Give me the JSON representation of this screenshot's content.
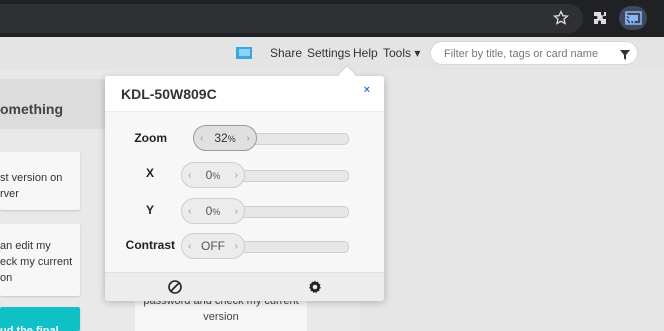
{
  "browser": {
    "icons": [
      "star-icon",
      "extensions-icon",
      "cast-icon"
    ]
  },
  "toolbar": {
    "menu": [
      "Share",
      "Settings",
      "Help",
      "Tools ▾"
    ],
    "search_placeholder": "Filter by title, tags or card name"
  },
  "board": {
    "list_title": "omething",
    "cards": [
      "st version on\nrver",
      "an edit my\neck my current\non",
      "ud the final"
    ],
    "right_card": "As a user I can edit my\npassword and check my current\nversion"
  },
  "cast_popup": {
    "device_name": "KDL-50W809C",
    "close_label": "×",
    "controls": [
      {
        "label": "Zoom",
        "value": "32",
        "unit": "%"
      },
      {
        "label": "X",
        "value": "0",
        "unit": "%"
      },
      {
        "label": "Y",
        "value": "0",
        "unit": "%"
      },
      {
        "label": "Contrast",
        "value": "OFF",
        "unit": ""
      }
    ],
    "footer_icons": [
      "stop-icon",
      "settings-icon"
    ]
  }
}
